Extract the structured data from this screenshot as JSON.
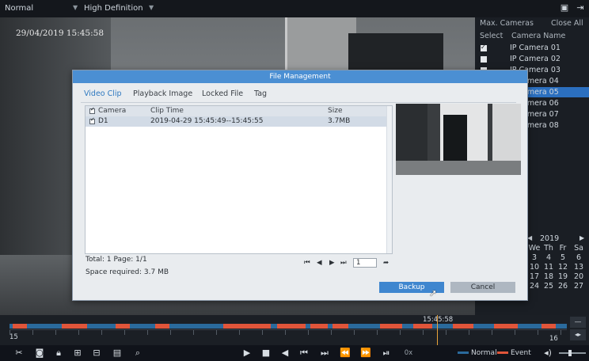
{
  "topbar": {
    "view_mode": "Normal",
    "stream_quality": "High Definition",
    "fullscreen_icon": "window-icon",
    "exit_icon": "exit-icon"
  },
  "video": {
    "timestamp": "29/04/2019 15:45:58"
  },
  "camera_panel": {
    "max_cameras_label": "Max. Cameras",
    "close_all_label": "Close All",
    "col_select": "Select",
    "col_name": "Camera Name",
    "cameras": [
      {
        "name": "IP Camera 01",
        "selected": true
      },
      {
        "name": "IP Camera 02",
        "selected": false
      },
      {
        "name": "IP Camera 03",
        "selected": false
      },
      {
        "name": "amera 04",
        "selected": false
      },
      {
        "name": "amera 05",
        "selected": false
      },
      {
        "name": "amera 06",
        "selected": false
      },
      {
        "name": "amera 07",
        "selected": false
      },
      {
        "name": "amera 08",
        "selected": false
      }
    ],
    "highlighted_row": 4
  },
  "calendar": {
    "year": "2019",
    "weekdays": [
      "We",
      "Th",
      "Fr",
      "Sa"
    ],
    "rows": [
      [
        "3",
        "4",
        "5",
        "6"
      ],
      [
        "10",
        "11",
        "12",
        "13"
      ],
      [
        "17",
        "18",
        "19",
        "20"
      ],
      [
        "24",
        "25",
        "26",
        "27"
      ]
    ]
  },
  "dialog": {
    "title": "File Management",
    "tabs": [
      "Video Clip",
      "Playback Image",
      "Locked File",
      "Tag"
    ],
    "active_tab": 0,
    "columns": [
      "Camera",
      "Clip Time",
      "Size"
    ],
    "rows": [
      {
        "camera": "D1",
        "clip_time": "2019-04-29 15:45:49--15:45:55",
        "size": "3.7MB",
        "checked": true
      }
    ],
    "total_text": "Total: 1  Page: 1/1",
    "space_text": "Space required: 3.7 MB",
    "page_input": "1",
    "backup_label": "Backup",
    "cancel_label": "Cancel"
  },
  "timeline": {
    "current_time": "15:45:58",
    "left_label": "15",
    "right_label": "16",
    "event_color": "#e0553a",
    "normal_color": "#2a6a9c"
  },
  "toolbar": {
    "speed": "0x",
    "legend_normal": "Normal",
    "legend_event": "Event"
  },
  "colors": {
    "accent": "#4b8fd3",
    "selected_row": "#2b6fbf"
  }
}
